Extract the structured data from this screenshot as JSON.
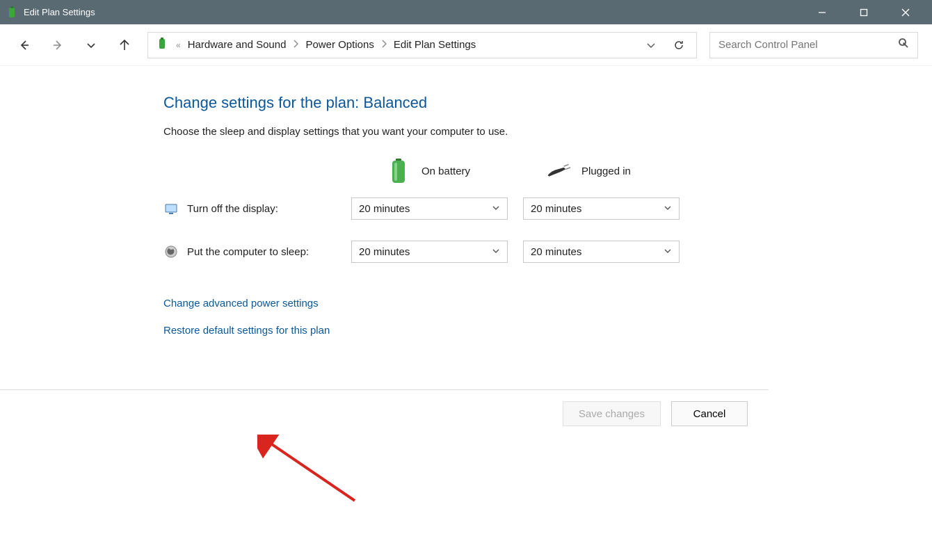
{
  "titlebar": {
    "title": "Edit Plan Settings"
  },
  "breadcrumb": {
    "item1": "Hardware and Sound",
    "item2": "Power Options",
    "item3": "Edit Plan Settings"
  },
  "search": {
    "placeholder": "Search Control Panel"
  },
  "heading": "Change settings for the plan: Balanced",
  "subheading": "Choose the sleep and display settings that you want your computer to use.",
  "columns": {
    "battery": "On battery",
    "plugged": "Plugged in"
  },
  "rows": {
    "display": {
      "label": "Turn off the display:",
      "battery_val": "20 minutes",
      "plugged_val": "20 minutes"
    },
    "sleep": {
      "label": "Put the computer to sleep:",
      "battery_val": "20 minutes",
      "plugged_val": "20 minutes"
    }
  },
  "links": {
    "advanced": "Change advanced power settings",
    "restore": "Restore default settings for this plan"
  },
  "buttons": {
    "save": "Save changes",
    "cancel": "Cancel"
  }
}
